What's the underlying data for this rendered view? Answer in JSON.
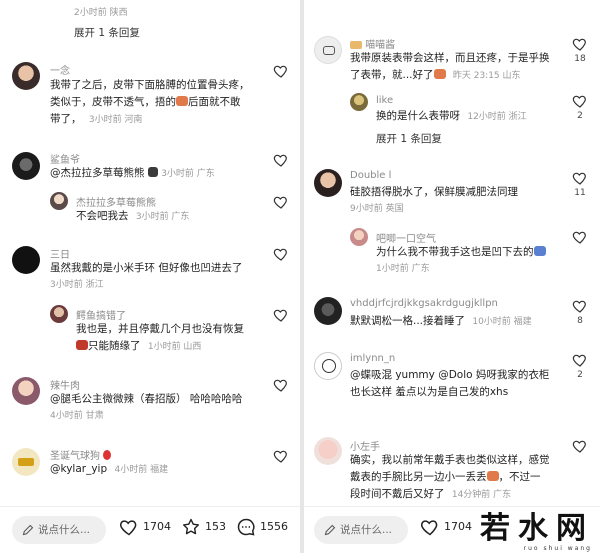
{
  "left": {
    "top_reply": {
      "meta": "2小时前 陕西",
      "expand": "展开 1 条回复"
    },
    "comments": [
      {
        "name": "一念",
        "text1": "我带了之后，皮带下面胳膊的位置骨头疼，",
        "text2": "类似于，皮带不透气，捂的",
        "text2b": "后面就不敢",
        "text3": "带了，",
        "meta": "3小时前 河南"
      },
      {
        "name": "鲨鱼爷",
        "text1": "@杰拉拉多草莓熊熊",
        "meta": "3小时前 广东",
        "reply": {
          "name": "杰拉拉多草莓熊熊",
          "text": "不会吧我去",
          "meta": "3小时前 广东"
        }
      },
      {
        "name": "三日",
        "text1": "虽然我戴的是小米手环 但好像也凹进去了",
        "meta": "3小时前 浙江",
        "reply": {
          "name": "鳄鱼搞错了",
          "text1": "我也是，并且停戴几个月也没有恢复",
          "text2": "只能随缘了",
          "meta": "1小时前 山西"
        }
      },
      {
        "name": "辣牛肉",
        "text1": "@腿毛公主微微辣（春招版） 哈哈哈哈哈",
        "meta": "4小时前 甘肃"
      },
      {
        "name": "圣诞气球狗",
        "text1": "@kylar_yip",
        "meta": "4小时前 福建"
      }
    ],
    "bar": {
      "placeholder": "说点什么...",
      "likes": "1704",
      "favorites": "153",
      "comments": "1556"
    }
  },
  "right": {
    "comments": [
      {
        "name": "喵喵酱",
        "text1": "我带原装表带会这样，而且还疼，于是乎换",
        "text2": "了表带，就...好了",
        "meta": "昨天 23:15 山东",
        "likes": "18",
        "reply": {
          "name": "like",
          "text": "换的是什么表带呀",
          "meta": "12小时前 浙江",
          "likes": "2"
        },
        "expand": "展开 1 条回复"
      },
      {
        "name": "Double l",
        "text1": "硅胶捂得脱水了，保鲜膜减肥法同理",
        "meta": "9小时前 英国",
        "likes": "11",
        "reply": {
          "name": "吧唧一口空气",
          "text": "为什么我不带我手这也是凹下去的",
          "meta": "1小时前 广东"
        }
      },
      {
        "name": "vhddjrfcjrdjkkgsakrdgugjkllpn",
        "text1": "默默调松一格...接着睡了",
        "meta": "10小时前 福建",
        "likes": "8"
      },
      {
        "name": "imlynn_n",
        "text1": "@蝶吸混 yummy @Dolo 妈呀我家的衣柜",
        "text2": "也长这样 羞点以为是自己发的xhs",
        "meta": "",
        "likes": "2"
      },
      {
        "name": "小左手",
        "text1": "确实，我以前常年戴手表也类似这样，感觉",
        "text2": "戴表的手腕比另一边小一丢丢",
        "text2b": "，不过一",
        "text3": "段时间不戴后又好了",
        "meta": "14分钟前 广东"
      }
    ],
    "bar": {
      "placeholder": "说点什么...",
      "likes": "1704"
    },
    "watermark": "若水网",
    "watermark_sub": "ruo shui wang"
  },
  "colors": {
    "accent": "#e8b96b",
    "meta": "#9a9a9a"
  }
}
